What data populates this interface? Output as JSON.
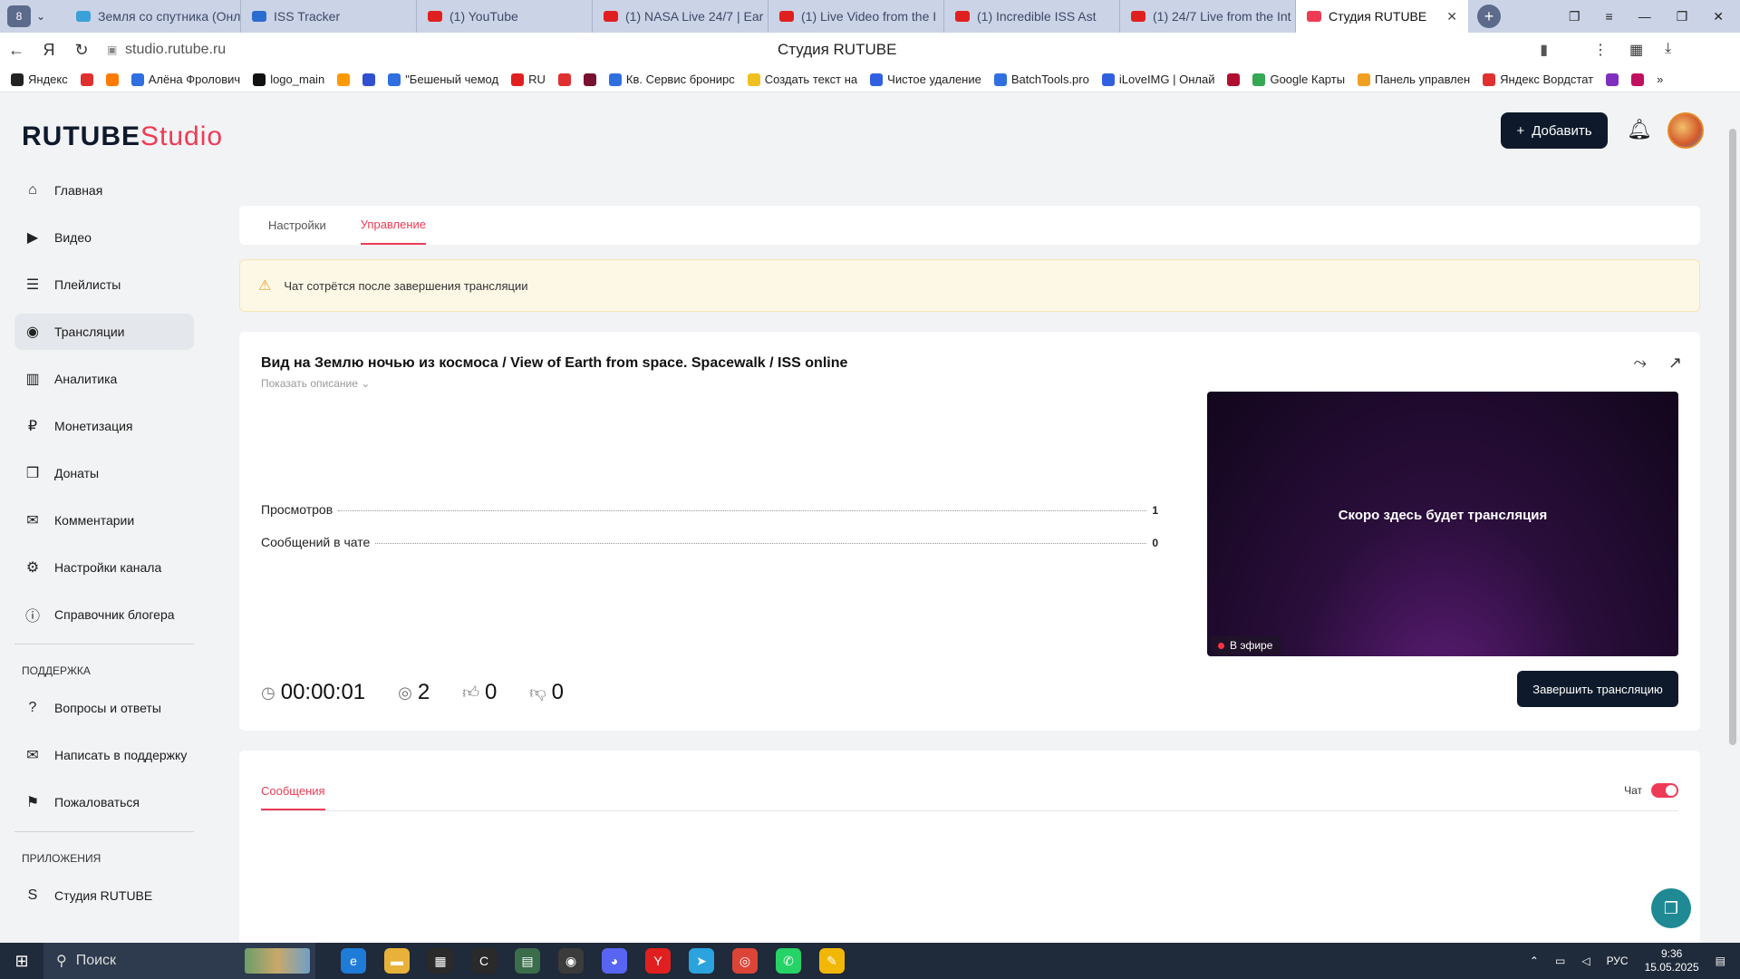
{
  "browser": {
    "tabs": [
      {
        "label": "Земля со спутника (Онл",
        "color": "#3aa0d8"
      },
      {
        "label": "ISS Tracker",
        "color": "#2b6cd0"
      },
      {
        "label": "(1) YouTube",
        "color": "#e02020"
      },
      {
        "label": "(1) NASA Live 24/7 | Ear",
        "color": "#e02020"
      },
      {
        "label": "(1) Live Video from the I",
        "color": "#e02020"
      },
      {
        "label": "(1) Incredible ISS Ast",
        "color": "#e02020"
      },
      {
        "label": "(1) 24/7 Live from the Int",
        "color": "#e02020"
      },
      {
        "label": "Студия RUTUBE",
        "color": "#ee3b55",
        "active": true
      }
    ],
    "left_badge": "8",
    "url": "studio.rutube.ru",
    "page_title": "Студия RUTUBE",
    "bookmarks": [
      {
        "label": "Яндекс",
        "color": "#222"
      },
      {
        "label": "",
        "color": "#e03030"
      },
      {
        "label": "",
        "color": "#ff7a00"
      },
      {
        "label": "Алёна Фролович",
        "color": "#2f6fe0"
      },
      {
        "label": "logo_main",
        "color": "#111"
      },
      {
        "label": "",
        "color": "#ff9a00"
      },
      {
        "label": "",
        "color": "#3050d0"
      },
      {
        "label": "\"Бешеный чемод",
        "color": "#2f6fe0"
      },
      {
        "label": "RU",
        "color": "#e02020"
      },
      {
        "label": "",
        "color": "#e03030"
      },
      {
        "label": "",
        "color": "#7a1030"
      },
      {
        "label": "Кв. Сервис бронирс",
        "color": "#2f6fe0"
      },
      {
        "label": "Создать текст на",
        "color": "#f0c020"
      },
      {
        "label": "Чистое удаление",
        "color": "#3060e0"
      },
      {
        "label": "BatchTools.pro",
        "color": "#2f6fe0"
      },
      {
        "label": "iLoveIMG | Онлай",
        "color": "#3060e0"
      },
      {
        "label": "",
        "color": "#b01030"
      },
      {
        "label": "Google Карты",
        "color": "#34a853"
      },
      {
        "label": "Панель управлен",
        "color": "#f0a020"
      },
      {
        "label": "Яндекс Вордстат",
        "color": "#e03030"
      },
      {
        "label": "",
        "color": "#8030c0"
      },
      {
        "label": "",
        "color": "#c01060"
      }
    ]
  },
  "app": {
    "logo_text": "RUTUBE",
    "logo_studio": "Studio",
    "add_button": "Добавить",
    "sidebar": {
      "items": [
        {
          "label": "Главная",
          "icon": "home-icon",
          "glyph": "⌂"
        },
        {
          "label": "Видео",
          "icon": "video-icon",
          "glyph": "▶"
        },
        {
          "label": "Плейлисты",
          "icon": "playlist-icon",
          "glyph": "☰"
        },
        {
          "label": "Трансляции",
          "icon": "broadcast-icon",
          "glyph": "◉",
          "active": true
        },
        {
          "label": "Аналитика",
          "icon": "analytics-icon",
          "glyph": "▥"
        },
        {
          "label": "Монетизация",
          "icon": "monetization-icon",
          "glyph": "₽"
        },
        {
          "label": "Донаты",
          "icon": "donate-icon",
          "glyph": "❒"
        },
        {
          "label": "Комментарии",
          "icon": "comments-icon",
          "glyph": "✉"
        },
        {
          "label": "Настройки канала",
          "icon": "gear-icon",
          "glyph": "⚙"
        },
        {
          "label": "Справочник блогера",
          "icon": "info-icon",
          "glyph": "ⓘ"
        }
      ],
      "support_heading": "ПОДДЕРЖКА",
      "support_items": [
        {
          "label": "Вопросы и ответы",
          "icon": "help-icon",
          "glyph": "?"
        },
        {
          "label": "Написать в поддержку",
          "icon": "mail-icon",
          "glyph": "✉"
        },
        {
          "label": "Пожаловаться",
          "icon": "flag-icon",
          "glyph": "⚑"
        }
      ],
      "apps_heading": "ПРИЛОЖЕНИЯ",
      "apps_items": [
        {
          "label": "Студия RUTUBE",
          "icon": "rutube-studio-icon",
          "glyph": "S"
        }
      ]
    },
    "tabs": [
      "Настройки",
      "Управление"
    ],
    "active_tab": "Управление",
    "warning": "Чат сотрётся после завершения трансляции",
    "stream": {
      "title": "Вид на Землю ночью из космоса / View of Earth from space. Spacewalk / ISS online",
      "show_description": "Показать описание",
      "stats": [
        {
          "label": "Просмотров",
          "value": "1"
        },
        {
          "label": "Сообщений в чате",
          "value": "0"
        }
      ],
      "player_text": "Скоро здесь будет трансляция",
      "live_badge": "В эфире",
      "end_button": "Завершить трансляцию",
      "duration": "00:00:01",
      "viewers": "2",
      "likes": "0",
      "dislikes": "0"
    },
    "messages_tab": "Сообщения",
    "chat_label": "Чат",
    "chat_enabled": true
  },
  "taskbar": {
    "search_label": "Поиск",
    "lang": "РУС",
    "time": "9:36",
    "date": "15.05.2025"
  }
}
